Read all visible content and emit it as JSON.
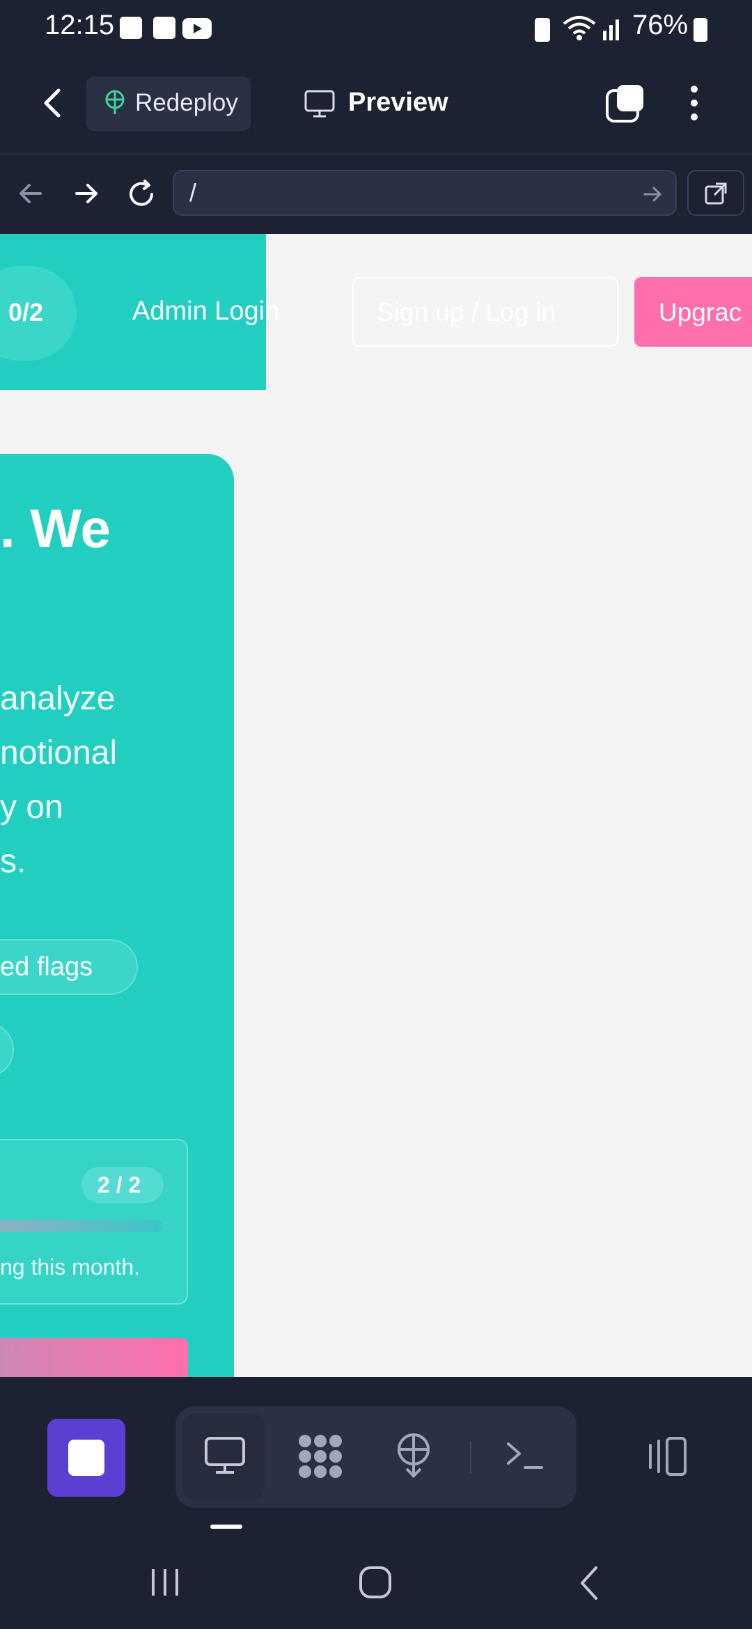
{
  "status_bar": {
    "time": "12:15",
    "battery": "76%",
    "icons": [
      "image-icon",
      "checkbox-icon",
      "youtube-icon",
      "battery-saver-icon",
      "wifi-icon",
      "signal-icon",
      "battery-icon"
    ]
  },
  "app_bar": {
    "back": "back-icon",
    "redeploy_label": "Redeploy",
    "preview_label": "Preview",
    "icons": [
      "copy-icon",
      "more-icon"
    ]
  },
  "browser": {
    "url": "/",
    "icons": [
      "back-arrow-icon",
      "forward-arrow-icon",
      "reload-icon",
      "go-arrow-icon",
      "external-link-icon"
    ]
  },
  "web": {
    "counter": "0/2",
    "admin_login": "Admin Login",
    "signup": "Sign up / Log in",
    "upgrade": "Upgrac",
    "hero_title": ". We",
    "hero_lines": [
      "analyze",
      "notional",
      "y on",
      "s."
    ],
    "pill_text": "ed flags",
    "usage": {
      "badge": "2 / 2",
      "progress": 1.0,
      "note": "ng this month."
    }
  },
  "toolbar": {
    "icons": [
      "stop-icon",
      "monitor-icon",
      "apps-icon",
      "deploy-icon",
      "terminal-icon",
      "device-icon"
    ]
  },
  "colors": {
    "background": "#1d2233",
    "teal": "#22cec0",
    "pink": "#ff6fae",
    "purple": "#5b3fd3"
  }
}
